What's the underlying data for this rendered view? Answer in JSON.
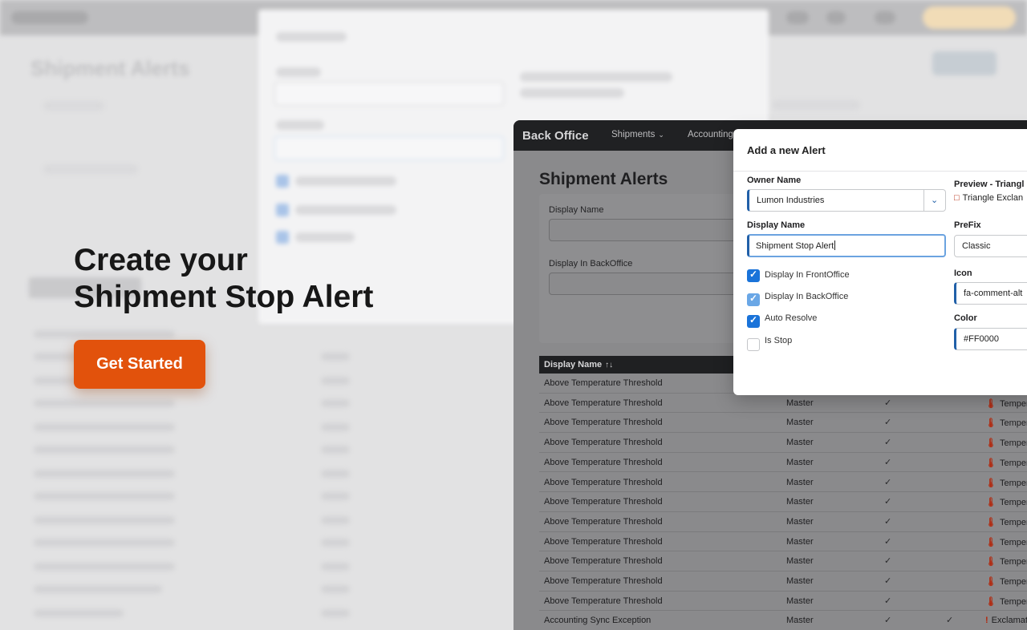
{
  "hero": {
    "heading_line1": "Create your",
    "heading_line2": "Shipment Stop Alert",
    "cta_label": "Get Started"
  },
  "app": {
    "brand": "Back Office",
    "nav": [
      {
        "label": "Shipments"
      },
      {
        "label": "Accounting"
      }
    ],
    "page_title": "Shipment Alerts",
    "filters": {
      "display_name_label": "Display Name",
      "display_in_backoffice_label": "Display In BackOffice"
    },
    "table": {
      "col_display_name": "Display Name",
      "rows": [
        {
          "name": "Above Temperature Threshold",
          "owner": "",
          "chk1": "",
          "chk2": "",
          "preview": ""
        },
        {
          "name": "Above Temperature Threshold",
          "owner": "Master",
          "chk1": "✓",
          "chk2": "",
          "preview": "Temper"
        },
        {
          "name": "Above Temperature Threshold",
          "owner": "Master",
          "chk1": "✓",
          "chk2": "",
          "preview": "Temper"
        },
        {
          "name": "Above Temperature Threshold",
          "owner": "Master",
          "chk1": "✓",
          "chk2": "",
          "preview": "Temper"
        },
        {
          "name": "Above Temperature Threshold",
          "owner": "Master",
          "chk1": "✓",
          "chk2": "",
          "preview": "Temper"
        },
        {
          "name": "Above Temperature Threshold",
          "owner": "Master",
          "chk1": "✓",
          "chk2": "",
          "preview": "Temper"
        },
        {
          "name": "Above Temperature Threshold",
          "owner": "Master",
          "chk1": "✓",
          "chk2": "",
          "preview": "Temper"
        },
        {
          "name": "Above Temperature Threshold",
          "owner": "Master",
          "chk1": "✓",
          "chk2": "",
          "preview": "Temper"
        },
        {
          "name": "Above Temperature Threshold",
          "owner": "Master",
          "chk1": "✓",
          "chk2": "",
          "preview": "Temper"
        },
        {
          "name": "Above Temperature Threshold",
          "owner": "Master",
          "chk1": "✓",
          "chk2": "",
          "preview": "Temper"
        },
        {
          "name": "Above Temperature Threshold",
          "owner": "Master",
          "chk1": "✓",
          "chk2": "",
          "preview": "Temper"
        },
        {
          "name": "Above Temperature Threshold",
          "owner": "Master",
          "chk1": "✓",
          "chk2": "",
          "preview": "Temper"
        },
        {
          "name": "Accounting Sync Exception",
          "owner": "Master",
          "chk1": "✓",
          "chk2": "✓",
          "preview": "Exclamati"
        }
      ]
    }
  },
  "modal": {
    "title": "Add a new Alert",
    "owner_name_label": "Owner Name",
    "owner_name_value": "Lumon Industries",
    "display_name_label": "Display Name",
    "display_name_value": "Shipment Stop Alert",
    "checkboxes": [
      {
        "label": "Display In FrontOffice",
        "state": "checked"
      },
      {
        "label": "Display In BackOffice",
        "state": "checked-light"
      },
      {
        "label": "Auto Resolve",
        "state": "checked"
      },
      {
        "label": "Is Stop",
        "state": "unchecked"
      }
    ],
    "preview_label": "Preview - Triangl",
    "preview_text": "Triangle Exclan",
    "prefix_label": "PreFix",
    "prefix_value": "Classic",
    "icon_label": "Icon",
    "icon_value": "fa-comment-alt",
    "color_label": "Color",
    "color_value": "#FF0000"
  },
  "colors": {
    "accent_orange": "#e2520c",
    "focus_blue": "#2160a8",
    "checkbox_blue": "#1a73d9",
    "alert_red": "#b3260b"
  }
}
